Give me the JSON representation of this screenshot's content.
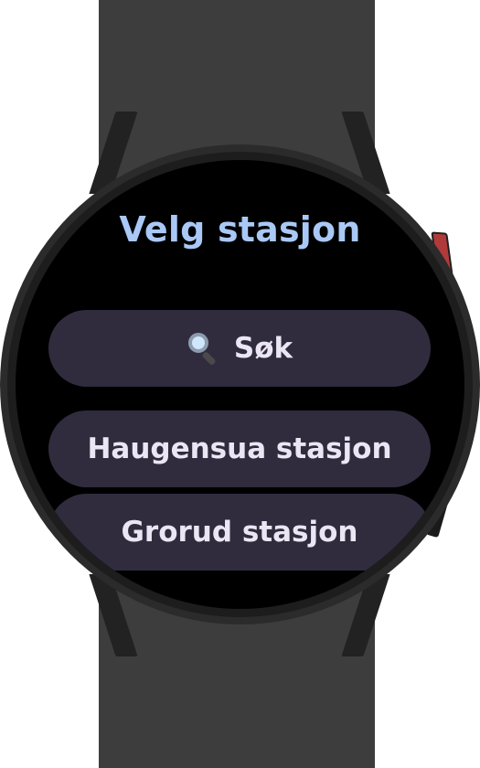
{
  "screen": {
    "title": "Velg stasjon",
    "search_button": {
      "icon": "magnifier-icon",
      "label": "Søk"
    },
    "stations": [
      {
        "label": "Haugensua stasjon"
      },
      {
        "label": "Grorud stasjon"
      }
    ]
  },
  "colors": {
    "title": "#a9c8f5",
    "chip_background": "#302c3e",
    "chip_text": "#ece6f4",
    "screen_background": "#000000",
    "band": "#3d3d3d",
    "crown_accent": "#b03a3a"
  }
}
